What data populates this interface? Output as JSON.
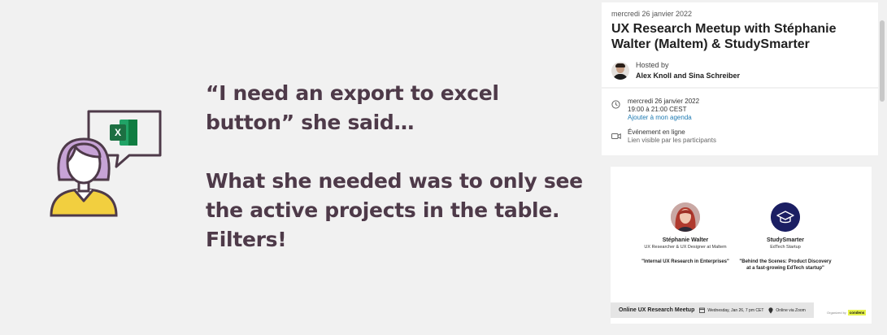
{
  "slide": {
    "quote_line1": "“I need an export to excel",
    "quote_line2": "button” she said…",
    "answer_line1": "What she needed was to only see",
    "answer_line2": "the active projects in the table.",
    "answer_line3": "Filters!",
    "icon": "person-with-excel-speech-bubble-illustration",
    "excel_letter": "X",
    "colors": {
      "text": "#4e3a49",
      "hair": "#c7a3d6",
      "shirt": "#f2cf3f",
      "excel": "#1d6f42"
    }
  },
  "event": {
    "date": "mercredi 26 janvier 2022",
    "title": "UX Research Meetup with Stéphanie Walter (Maltem) & StudySmarter",
    "host_label": "Hosted by",
    "host_names": "Alex Knoll and Sina Schreiber",
    "host_avatar_icon": "host-avatar"
  },
  "details": {
    "datetime_icon": "clock-icon",
    "datetime_date": "mercredi 26 janvier 2022",
    "datetime_time": "19:00 à 21:00 CEST",
    "add_calendar": "Ajouter à mon agenda",
    "online_icon": "video-camera-icon",
    "online_title": "Événement en ligne",
    "online_sub": "Lien visible par les participants"
  },
  "banner": {
    "speaker1_name": "Stéphanie Walter",
    "speaker1_role": "UX Researcher & UX Designer at Maltem",
    "speaker1_talk": "\"Internal UX Research in Enterprises\"",
    "speaker2_name": "StudySmarter",
    "speaker2_role": "EdTech Startup",
    "speaker2_talk": "\"Behind the Scenes: Product Discovery at a fast-growing EdTech startup\"",
    "footer_title": "Online UX Research Meetup",
    "footer_date": "Wednesday, Jan 26, 7 pm CET",
    "footer_location": "Online via Zoom",
    "organized_by": "Organized by",
    "brand": "condens"
  }
}
